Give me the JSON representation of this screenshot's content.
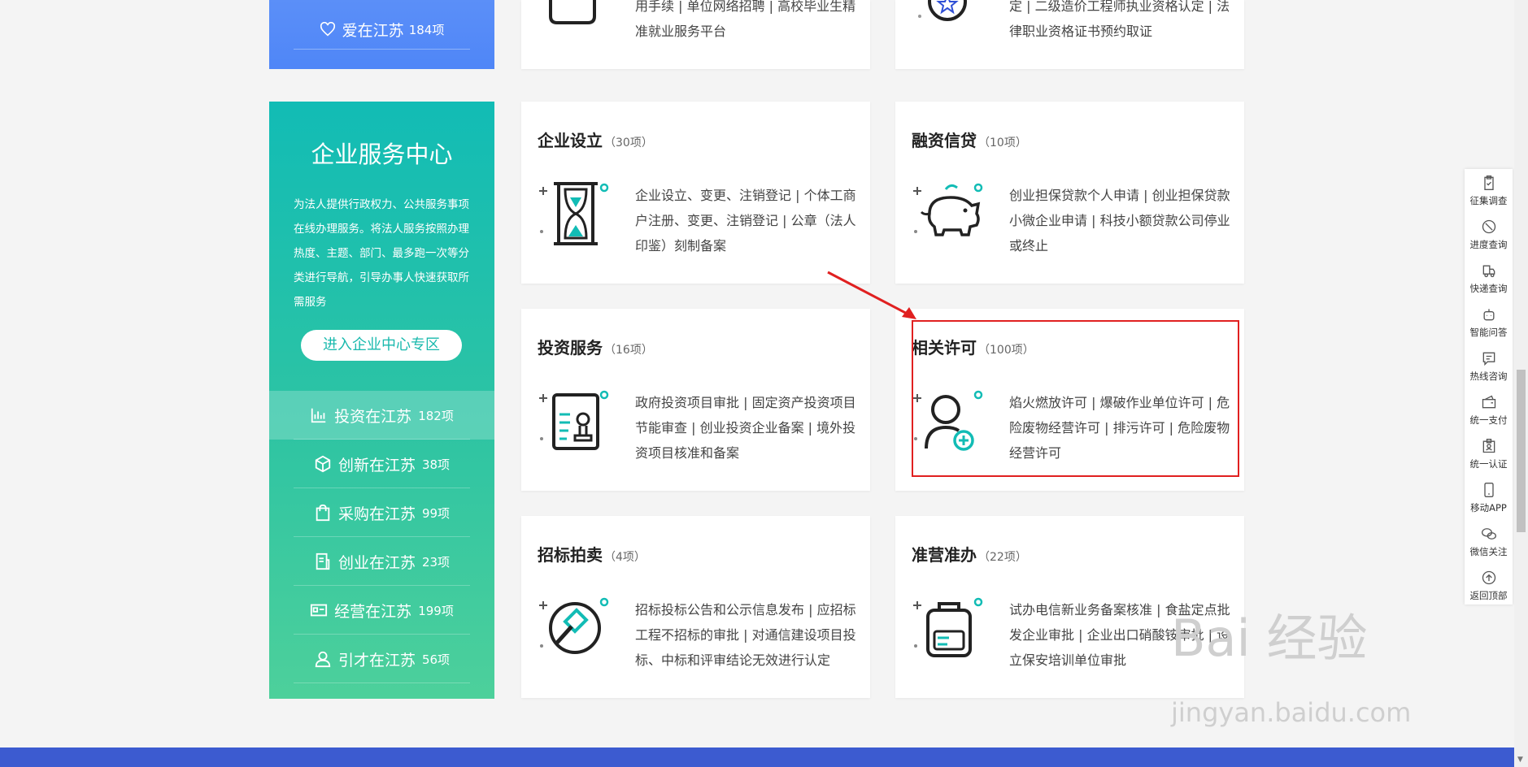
{
  "top_left": {
    "label": "爱在江苏",
    "count": "184项"
  },
  "top_cards": [
    {
      "desc": "用手续 | 单位网络招聘 | 高校毕业生精准就业服务平台"
    },
    {
      "desc": "定 | 二级造价工程师执业资格认定 | 法律职业资格证书预约取证"
    }
  ],
  "enterprise": {
    "title": "企业服务中心",
    "desc": "为法人提供行政权力、公共服务事项在线办理服务。将法人服务按照办理热度、主题、部门、最多跑一次等分类进行导航，引导办事人快速获取所需服务",
    "button": "进入企业中心专区",
    "nav": [
      {
        "label": "投资在江苏",
        "count": "182项",
        "icon": "bar-chart-icon"
      },
      {
        "label": "创新在江苏",
        "count": "38项",
        "icon": "cube-icon"
      },
      {
        "label": "采购在江苏",
        "count": "99项",
        "icon": "shopping-bag-icon"
      },
      {
        "label": "创业在江苏",
        "count": "23项",
        "icon": "document-icon"
      },
      {
        "label": "经营在江苏",
        "count": "199项",
        "icon": "id-card-icon"
      },
      {
        "label": "引才在江苏",
        "count": "56项",
        "icon": "person-icon"
      }
    ]
  },
  "cards": [
    {
      "title": "企业设立",
      "count": "（30项）",
      "desc": "企业设立、变更、注销登记 | 个体工商户注册、变更、注销登记 | 公章（法人印鉴）刻制备案",
      "icon": "hourglass-icon"
    },
    {
      "title": "融资信贷",
      "count": "（10项）",
      "desc": "创业担保贷款个人申请 | 创业担保贷款小微企业申请 | 科技小额贷款公司停业或终止",
      "icon": "piggy-bank-icon"
    },
    {
      "title": "投资服务",
      "count": "（16项）",
      "desc": "政府投资项目审批 | 固定资产投资项目节能审查 | 创业投资企业备案 | 境外投资项目核准和备案",
      "icon": "certificate-icon"
    },
    {
      "title": "相关许可",
      "count": "（100项）",
      "desc": "焰火燃放许可 | 爆破作业单位许可 | 危险废物经营许可 | 排污许可 | 危险废物经营许可",
      "icon": "user-add-icon"
    },
    {
      "title": "招标拍卖",
      "count": "（4项）",
      "desc": "招标投标公告和公示信息发布 | 应招标工程不招标的审批 | 对通信建设项目投标、中标和评审结论无效进行认定",
      "icon": "gavel-icon"
    },
    {
      "title": "准营准办",
      "count": "（22项）",
      "desc": "试办电信新业务备案核准 | 食盐定点批发企业审批 | 企业出口硝酸铵审批 | 设立保安培训单位审批",
      "icon": "briefcase-icon"
    }
  ],
  "toolbar": [
    {
      "label": "征集调查",
      "icon": "clipboard-icon"
    },
    {
      "label": "进度查询",
      "icon": "progress-icon"
    },
    {
      "label": "快递查询",
      "icon": "truck-icon"
    },
    {
      "label": "智能问答",
      "icon": "robot-icon"
    },
    {
      "label": "热线咨询",
      "icon": "chat-icon"
    },
    {
      "label": "统一支付",
      "icon": "wallet-icon"
    },
    {
      "label": "统一认证",
      "icon": "badge-icon"
    },
    {
      "label": "移动APP",
      "icon": "phone-icon"
    },
    {
      "label": "微信关注",
      "icon": "wechat-icon"
    },
    {
      "label": "返回顶部",
      "icon": "arrow-up-icon"
    }
  ],
  "watermark": {
    "line1": "Bai 经验",
    "line2": "jingyan.baidu.com"
  },
  "colors": {
    "accent": "#12bcb5",
    "highlight": "#e02020",
    "blue": "#4f86f7",
    "footer": "#3c5bd0"
  }
}
